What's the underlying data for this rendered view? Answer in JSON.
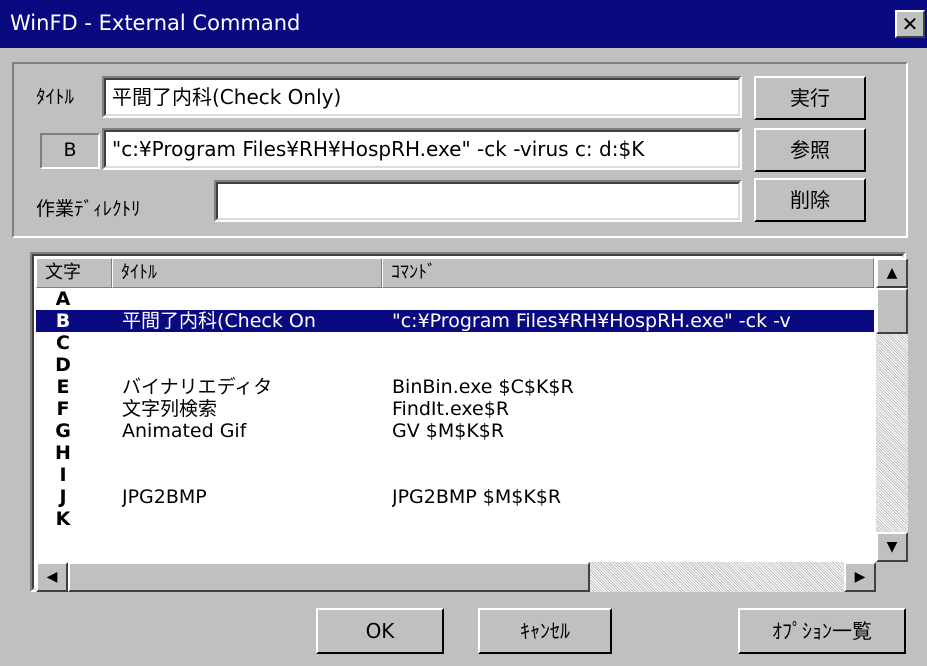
{
  "window": {
    "title": "WinFD - External Command",
    "close_glyph": "✕"
  },
  "form": {
    "title_label": "ﾀｲﾄﾙ",
    "title_value": "平間了内科(Check Only)",
    "key_value": "B",
    "command_value": "\"c:¥Program Files¥RH¥HospRH.exe\" -ck -virus c: d:$K",
    "workdir_label": "作業ﾃﾞｨﾚｸﾄﾘ",
    "workdir_value": ""
  },
  "buttons": {
    "run": "実行",
    "browse": "参照",
    "delete": "削除",
    "ok": "OK",
    "cancel": "ｷｬﾝｾﾙ",
    "options": "ｵﾌﾟｼｮﾝ一覧"
  },
  "list": {
    "headers": {
      "key": "文字",
      "title": "ﾀｲﾄﾙ",
      "command": "ｺﾏﾝﾄﾞ"
    },
    "rows": [
      {
        "key": "A",
        "title": "",
        "command": ""
      },
      {
        "key": "B",
        "title": "平間了内科(Check On",
        "command": "\"c:¥Program Files¥RH¥HospRH.exe\" -ck -v"
      },
      {
        "key": "C",
        "title": "",
        "command": ""
      },
      {
        "key": "D",
        "title": "",
        "command": ""
      },
      {
        "key": "E",
        "title": "バイナリエディタ",
        "command": "BinBin.exe $C$K$R"
      },
      {
        "key": "F",
        "title": "文字列検索",
        "command": "FindIt.exe$R"
      },
      {
        "key": "G",
        "title": "Animated Gif",
        "command": "GV $M$K$R"
      },
      {
        "key": "H",
        "title": "",
        "command": ""
      },
      {
        "key": "I",
        "title": "",
        "command": ""
      },
      {
        "key": "J",
        "title": "JPG2BMP",
        "command": "JPG2BMP $M$K$R"
      },
      {
        "key": "K",
        "title": "",
        "command": ""
      }
    ],
    "selected_key": "B"
  },
  "scroll": {
    "up": "▲",
    "down": "▼",
    "left": "◀",
    "right": "▶"
  }
}
